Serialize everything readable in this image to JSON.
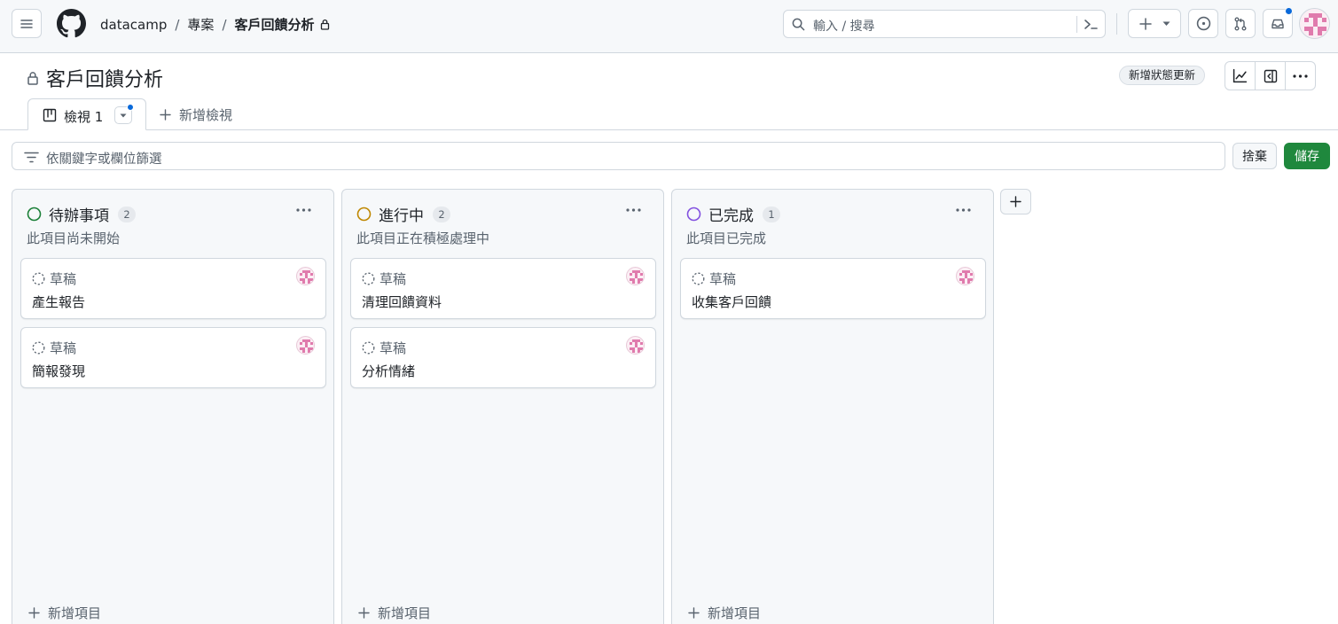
{
  "header": {
    "breadcrumbs": [
      "datacamp",
      "專案",
      "客戶回饋分析"
    ],
    "search_placeholder": "輸入 / 搜尋"
  },
  "project": {
    "title": "客戶回饋分析",
    "status_update_label": "新增狀態更新"
  },
  "views": {
    "active_tab": "檢視 1",
    "new_view_label": "新增檢視"
  },
  "filter": {
    "placeholder": "依關鍵字或欄位篩選",
    "discard_label": "捨棄",
    "save_label": "儲存"
  },
  "columns": [
    {
      "title": "待辦事項",
      "count": "2",
      "description": "此項目尚未開始",
      "status_color": "#1a7f37",
      "add_item_label": "新增項目",
      "cards": [
        {
          "meta": "草稿",
          "title": "產生報告"
        },
        {
          "meta": "草稿",
          "title": "簡報發現"
        }
      ]
    },
    {
      "title": "進行中",
      "count": "2",
      "description": "此項目正在積極處理中",
      "status_color": "#bf8700",
      "add_item_label": "新增項目",
      "cards": [
        {
          "meta": "草稿",
          "title": "清理回饋資料"
        },
        {
          "meta": "草稿",
          "title": "分析情緒"
        }
      ]
    },
    {
      "title": "已完成",
      "count": "1",
      "description": "此項目已完成",
      "status_color": "#8250df",
      "add_item_label": "新增項目",
      "cards": [
        {
          "meta": "草稿",
          "title": "收集客戶回饋"
        }
      ]
    }
  ],
  "colors": {
    "accent": "#0969da",
    "save_green": "#1f883d",
    "border": "#d0d7de",
    "muted_text": "#59636e"
  }
}
